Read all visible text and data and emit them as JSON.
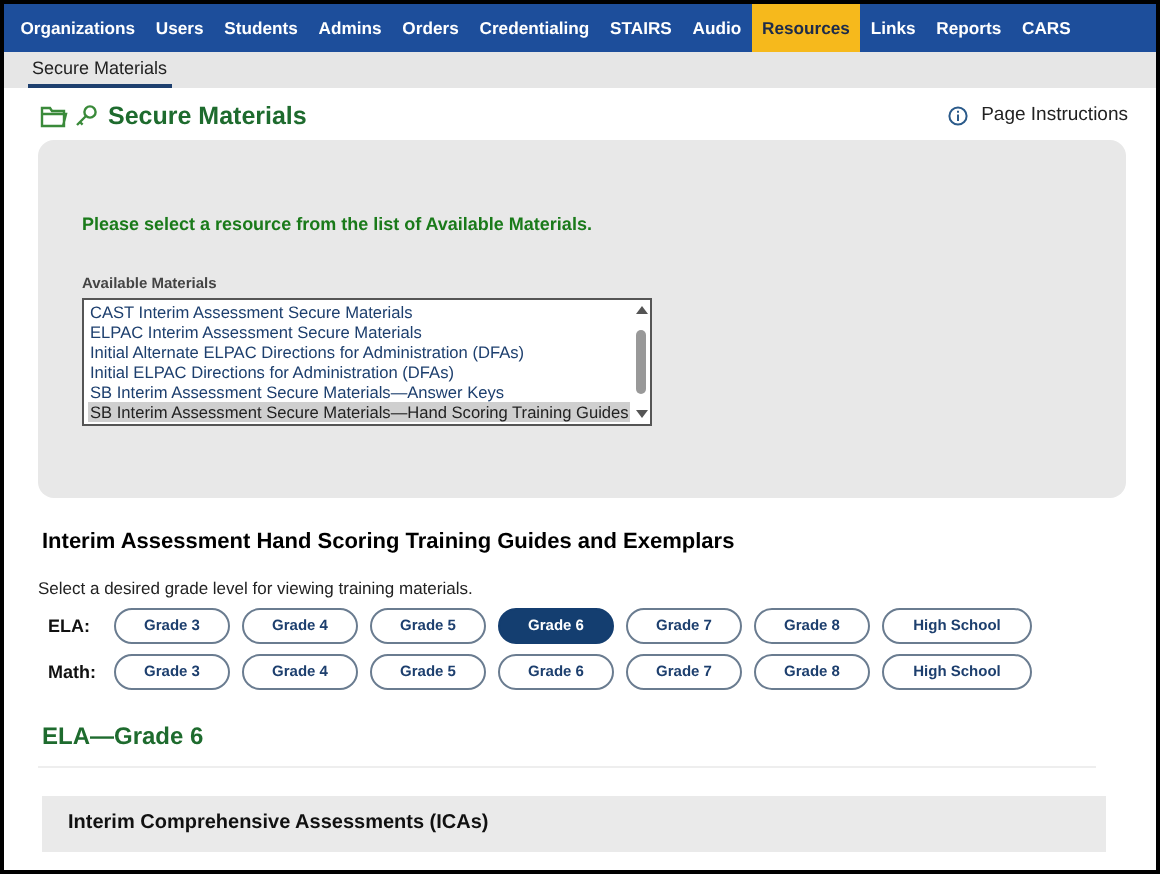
{
  "nav": {
    "items": [
      {
        "label": "Organizations",
        "selected": false
      },
      {
        "label": "Users",
        "selected": false
      },
      {
        "label": "Students",
        "selected": false
      },
      {
        "label": "Admins",
        "selected": false
      },
      {
        "label": "Orders",
        "selected": false
      },
      {
        "label": "Credentialing",
        "selected": false
      },
      {
        "label": "STAIRS",
        "selected": false
      },
      {
        "label": "Audio",
        "selected": false
      },
      {
        "label": "Resources",
        "selected": true
      },
      {
        "label": "Links",
        "selected": false
      },
      {
        "label": "Reports",
        "selected": false
      },
      {
        "label": "CARS",
        "selected": false
      }
    ]
  },
  "subnav": {
    "items": [
      {
        "label": "Secure Materials",
        "selected": true
      }
    ]
  },
  "page": {
    "title": "Secure Materials",
    "instructions_link": "Page Instructions"
  },
  "resource_panel": {
    "prompt": "Please select a resource from the list of Available Materials.",
    "list_label": "Available Materials",
    "materials": [
      {
        "label": "CAST Interim Assessment Secure Materials",
        "selected": false
      },
      {
        "label": "ELPAC Interim Assessment Secure Materials",
        "selected": false
      },
      {
        "label": "Initial Alternate ELPAC Directions for Administration (DFAs)",
        "selected": false
      },
      {
        "label": "Initial ELPAC Directions for Administration (DFAs)",
        "selected": false
      },
      {
        "label": "SB Interim Assessment Secure Materials—Answer Keys",
        "selected": false
      },
      {
        "label": "SB Interim Assessment Secure Materials—Hand Scoring Training Guides",
        "selected": true
      }
    ]
  },
  "training": {
    "heading": "Interim Assessment Hand Scoring Training Guides and Exemplars",
    "instruction": "Select a desired grade level for viewing training materials.",
    "subjects": [
      {
        "label": "ELA:",
        "grades": [
          {
            "label": "Grade 3",
            "selected": false
          },
          {
            "label": "Grade 4",
            "selected": false
          },
          {
            "label": "Grade 5",
            "selected": false
          },
          {
            "label": "Grade 6",
            "selected": true
          },
          {
            "label": "Grade 7",
            "selected": false
          },
          {
            "label": "Grade 8",
            "selected": false
          },
          {
            "label": "High School",
            "selected": false
          }
        ]
      },
      {
        "label": "Math:",
        "grades": [
          {
            "label": "Grade 3",
            "selected": false
          },
          {
            "label": "Grade 4",
            "selected": false
          },
          {
            "label": "Grade 5",
            "selected": false
          },
          {
            "label": "Grade 6",
            "selected": false
          },
          {
            "label": "Grade 7",
            "selected": false
          },
          {
            "label": "Grade 8",
            "selected": false
          },
          {
            "label": "High School",
            "selected": false
          }
        ]
      }
    ]
  },
  "result": {
    "heading": "ELA—Grade 6",
    "sections": [
      {
        "title": "Interim Comprehensive Assessments (ICAs)"
      }
    ]
  }
}
